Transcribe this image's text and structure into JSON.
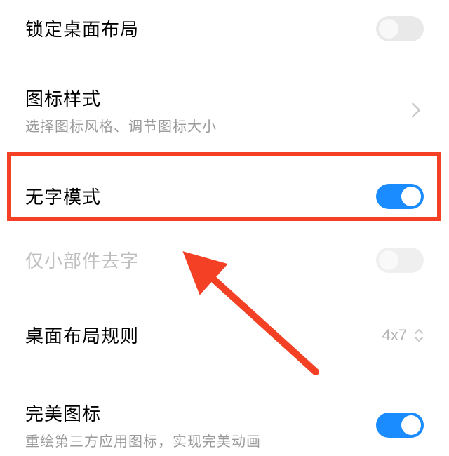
{
  "settings": {
    "lockLayout": {
      "title": "锁定桌面布局",
      "on": false
    },
    "iconStyle": {
      "title": "图标样式",
      "subtitle": "选择图标风格、调节图标大小"
    },
    "textlessMode": {
      "title": "无字模式",
      "on": true
    },
    "widgetTextless": {
      "title": "仅小部件去字",
      "on": false,
      "disabled": true
    },
    "layoutRule": {
      "title": "桌面布局规则",
      "value": "4x7"
    },
    "perfectIcon": {
      "title": "完美图标",
      "subtitle": "重绘第三方应用图标，实现完美动画",
      "on": true
    }
  },
  "annotation": {
    "highlightColor": "#f44125"
  }
}
